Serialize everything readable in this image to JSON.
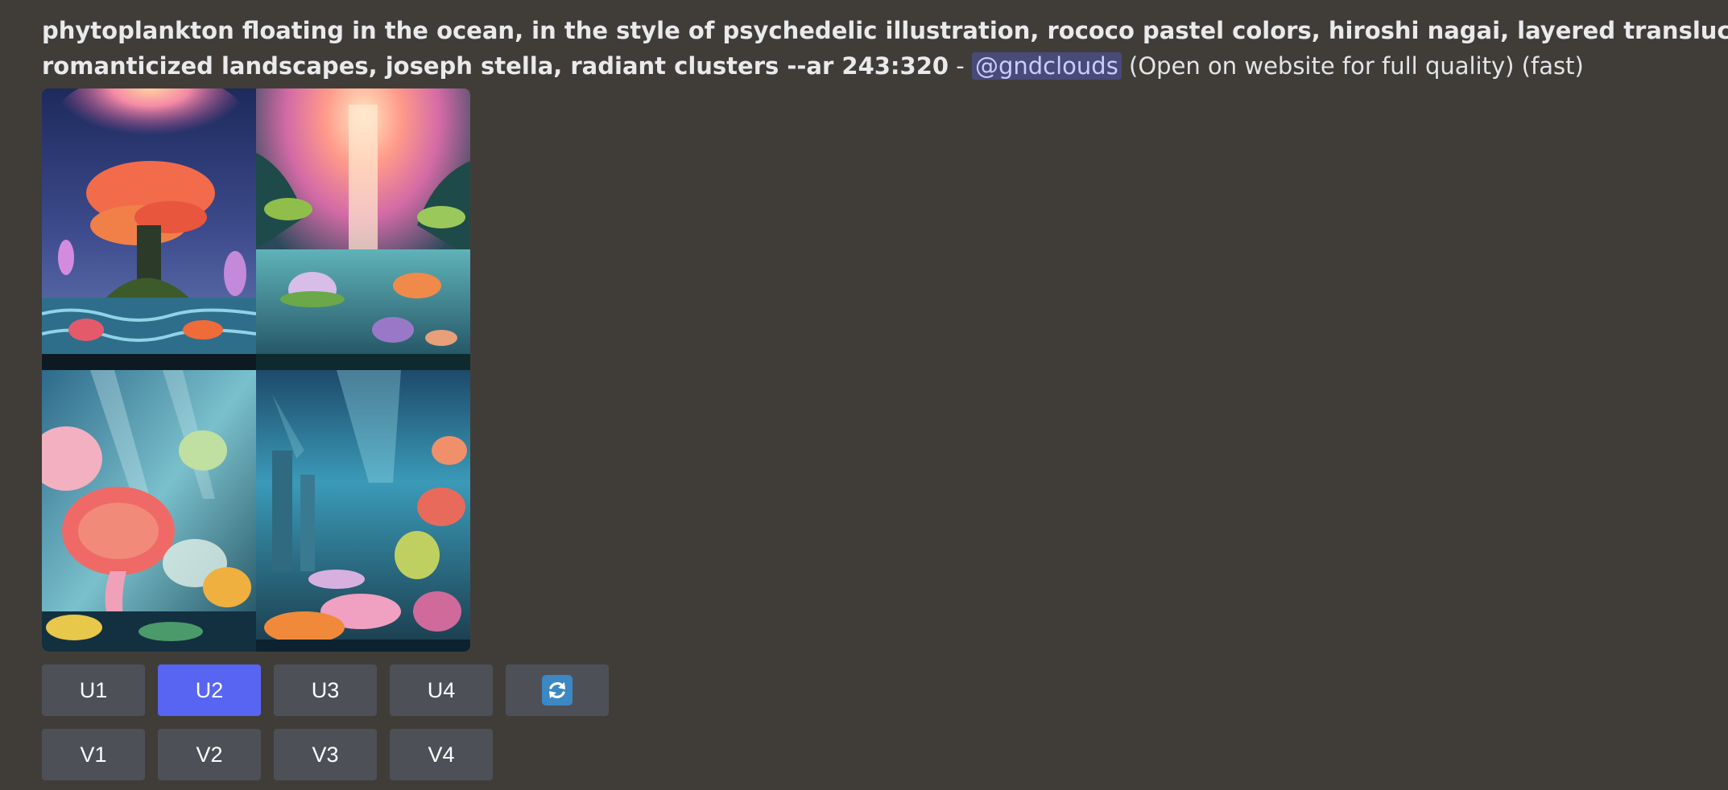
{
  "message": {
    "prompt_line1": "phytoplankton floating in the ocean, in the style of psychedelic illustration, rococo pastel colors, hiroshi nagai, layered translucency,",
    "prompt_line2": "romanticized landscapes, joseph stella, radiant clusters --ar 243:320",
    "separator": " - ",
    "mention": "@gndclouds",
    "suffix": " (Open on website for full quality) (fast)"
  },
  "buttons": {
    "upscale": [
      "U1",
      "U2",
      "U3",
      "U4"
    ],
    "variation": [
      "V1",
      "V2",
      "V3",
      "V4"
    ],
    "active": "U2",
    "reroll_icon": "refresh-icon"
  },
  "colors": {
    "background": "#403d38",
    "button": "#4e5058",
    "button_active": "#5865f2",
    "mention_bg": "#5865f2",
    "refresh_icon": "#3b88c3"
  }
}
